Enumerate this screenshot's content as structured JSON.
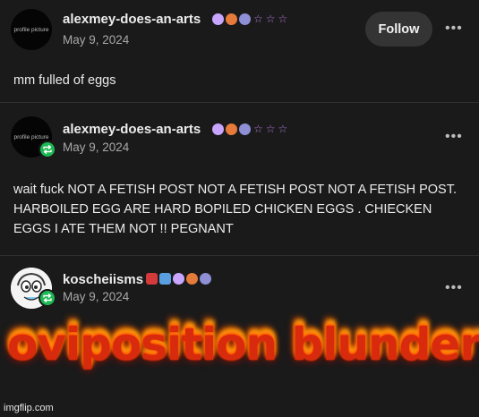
{
  "posts": [
    {
      "avatar_text": "profile picture",
      "username": "alexmey-does-an-arts",
      "date": "May 9, 2024",
      "follow_label": "Follow",
      "body": "mm fulled of eggs",
      "badge_colors": [
        "#c8a6ff",
        "#e67a3a",
        "#8f8fd6"
      ],
      "badge_glyphs": [
        "☆",
        "☆",
        "☆"
      ]
    },
    {
      "avatar_text": "profile picture",
      "username": "alexmey-does-an-arts",
      "date": "May 9, 2024",
      "body": "wait fuck NOT A FETISH POST NOT A FETISH POST NOT A FETISH POST. HARBOILED EGG ARE HARD BOPILED CHICKEN EGGS . CHIECKEN EGGS I ATE THEM NOT !! PEGNANT",
      "badge_colors": [
        "#c8a6ff",
        "#e67a3a",
        "#8f8fd6"
      ],
      "badge_glyphs": [
        "☆",
        "☆",
        "☆"
      ]
    },
    {
      "username": "koscheiisms",
      "date": "May 9, 2024",
      "overlay_text": "oviposition blunder",
      "badge_colors": [
        "#d43a3a",
        "#5aa0e0",
        "#c8a6ff",
        "#e67a3a",
        "#8f8fd6"
      ]
    }
  ],
  "icons": {
    "more": "more-horizontal-icon",
    "reblog": "reblog-icon"
  },
  "colors": {
    "background": "#1a1a1a",
    "reblog_green": "#1db954",
    "flame_red": "#d82a0c"
  },
  "watermark": "imgflip.com"
}
